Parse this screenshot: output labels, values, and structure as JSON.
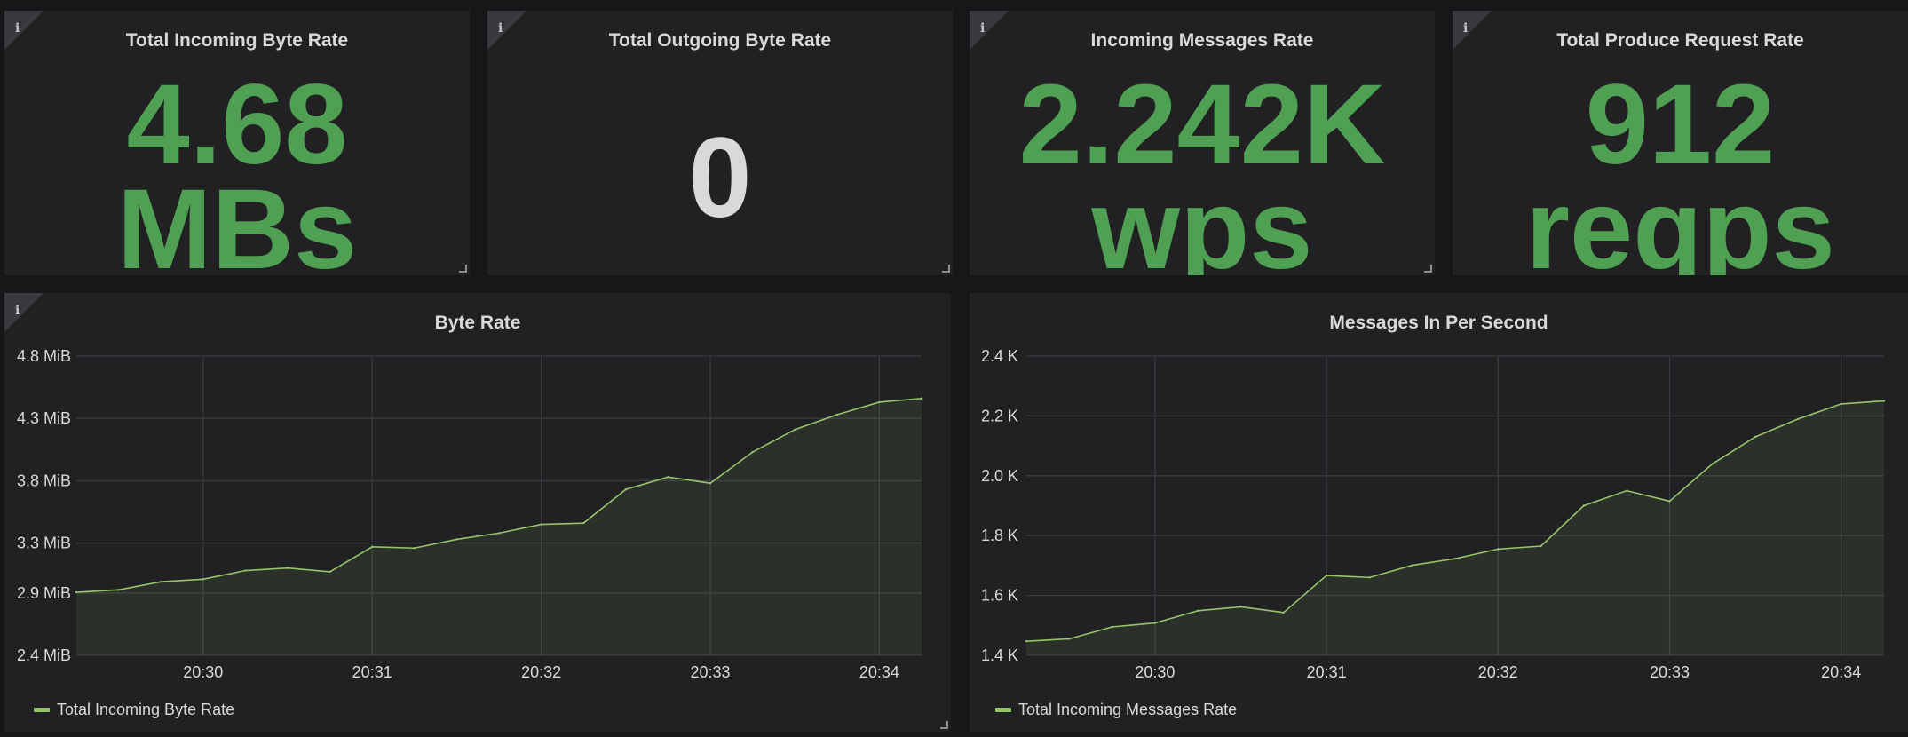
{
  "stats": [
    {
      "title": "Total Incoming Byte Rate",
      "line1": "4.68",
      "line2": "MBs",
      "color": "#4fa052"
    },
    {
      "title": "Total Outgoing Byte Rate",
      "line1": "0",
      "line2": "",
      "color": "#d8d9da"
    },
    {
      "title": "Incoming Messages Rate",
      "line1": "2.242K",
      "line2": "wps",
      "color": "#4fa052"
    },
    {
      "title": "Total Produce Request Rate",
      "line1": "912",
      "line2": "reqps",
      "color": "#4fa052"
    }
  ],
  "info_icon": "info-icon",
  "colors": {
    "background": "#161719",
    "panel": "#212124",
    "accent_green": "#4fa052",
    "series_line": "#96c46a",
    "text": "#d8d9da"
  },
  "charts": {
    "byte_rate": {
      "title": "Byte Rate",
      "legend": "Total Incoming Byte Rate"
    },
    "messages": {
      "title": "Messages In Per Second",
      "legend": "Total Incoming Messages Rate"
    }
  },
  "chart_data": [
    {
      "type": "area",
      "title": "Byte Rate",
      "series": [
        {
          "name": "Total Incoming Byte Rate",
          "x": [
            "20:29:15",
            "20:29:30",
            "20:29:45",
            "20:30:00",
            "20:30:15",
            "20:30:30",
            "20:30:45",
            "20:31:00",
            "20:31:15",
            "20:31:30",
            "20:31:45",
            "20:32:00",
            "20:32:15",
            "20:32:30",
            "20:32:45",
            "20:33:00",
            "20:33:15",
            "20:33:30",
            "20:33:45",
            "20:34:00",
            "20:34:15"
          ],
          "values": [
            2.905,
            2.925,
            2.99,
            3.01,
            3.08,
            3.1,
            3.07,
            3.27,
            3.26,
            3.33,
            3.38,
            3.45,
            3.46,
            3.73,
            3.83,
            3.78,
            4.03,
            4.21,
            4.33,
            4.43,
            4.46
          ]
        }
      ],
      "x_ticks": [
        "20:30",
        "20:31",
        "20:32",
        "20:33",
        "20:34"
      ],
      "x_tick_values": [
        "20:30:00",
        "20:31:00",
        "20:32:00",
        "20:33:00",
        "20:34:00"
      ],
      "y_ticks": [
        "2.4 MiB",
        "2.9 MiB",
        "3.3 MiB",
        "3.8 MiB",
        "4.3 MiB",
        "4.8 MiB"
      ],
      "y_tick_values": [
        2.4,
        2.9,
        3.3,
        3.8,
        4.3,
        4.8
      ],
      "ylim": [
        2.4,
        4.8
      ],
      "xlim": [
        "20:29:15",
        "20:34:15"
      ],
      "grid": true,
      "legend_position": "bottom-left"
    },
    {
      "type": "area",
      "title": "Messages In Per Second",
      "series": [
        {
          "name": "Total Incoming Messages Rate",
          "x": [
            "20:29:15",
            "20:29:30",
            "20:29:45",
            "20:30:00",
            "20:30:15",
            "20:30:30",
            "20:30:45",
            "20:31:00",
            "20:31:15",
            "20:31:30",
            "20:31:45",
            "20:32:00",
            "20:32:15",
            "20:32:30",
            "20:32:45",
            "20:33:00",
            "20:33:15",
            "20:33:30",
            "20:33:45",
            "20:34:00",
            "20:34:15"
          ],
          "values": [
            1.447,
            1.455,
            1.495,
            1.508,
            1.549,
            1.562,
            1.543,
            1.667,
            1.66,
            1.701,
            1.723,
            1.755,
            1.765,
            1.9,
            1.95,
            1.915,
            2.04,
            2.13,
            2.19,
            2.24,
            2.25
          ]
        }
      ],
      "x_ticks": [
        "20:30",
        "20:31",
        "20:32",
        "20:33",
        "20:34"
      ],
      "x_tick_values": [
        "20:30:00",
        "20:31:00",
        "20:32:00",
        "20:33:00",
        "20:34:00"
      ],
      "y_ticks": [
        "1.4 K",
        "1.6 K",
        "1.8 K",
        "2.0 K",
        "2.2 K",
        "2.4 K"
      ],
      "y_tick_values": [
        1.4,
        1.6,
        1.8,
        2.0,
        2.2,
        2.4
      ],
      "ylim": [
        1.4,
        2.4
      ],
      "xlim": [
        "20:29:15",
        "20:34:15"
      ],
      "grid": true,
      "legend_position": "bottom-left"
    }
  ]
}
